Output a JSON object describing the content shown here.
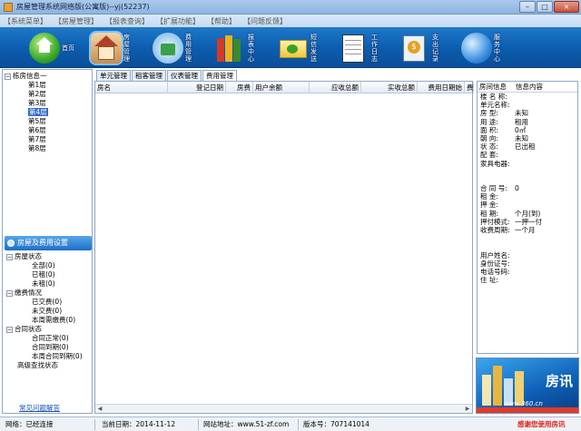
{
  "window": {
    "title": "房屋管理系统网络版(公寓版)--yj(52237)",
    "buttons": [
      "–",
      "□",
      "×"
    ]
  },
  "menu": [
    "【系统菜单】",
    "【房屋管理】",
    "【报表查询】",
    "【扩展功能】",
    "【帮助】",
    "【问题反馈】"
  ],
  "toolbar": [
    {
      "label": "首页",
      "icon": "home-icon"
    },
    {
      "label": "房屋管理",
      "icon": "house-icon"
    },
    {
      "label": "费用管理",
      "icon": "money-house-icon"
    },
    {
      "label": "报表中心",
      "icon": "report-books-icon"
    },
    {
      "label": "短信发送",
      "icon": "sms-envelope-icon"
    },
    {
      "label": "工作日志",
      "icon": "notebook-icon"
    },
    {
      "label": "支出记录",
      "icon": "expense-icon"
    },
    {
      "label": "服务中心",
      "icon": "globe-icon"
    }
  ],
  "tree": {
    "root": "栋房信息一",
    "floors": [
      "第1层",
      "第2层",
      "第3层",
      "第4层",
      "第5层",
      "第6层",
      "第7层",
      "第8层"
    ],
    "selected_index": 3
  },
  "section_header": "房屋及费用设置",
  "status_tree": [
    {
      "label": "房屋状态",
      "children": [
        "全部(0)",
        "已租(0)",
        "未租(0)"
      ]
    },
    {
      "label": "缴费情况",
      "children": [
        "已交费(0)",
        "未交费(0)",
        "本周需缴费(0)"
      ]
    },
    {
      "label": "合同状态",
      "children": [
        "合同正常(0)",
        "合同到期(0)",
        "本周合同到期(0)"
      ]
    },
    {
      "label": "高级查找状态",
      "children": []
    }
  ],
  "help_link": "常见问题解答",
  "tabs": [
    "单元管理",
    "租客管理",
    "仪表管理",
    "费用管理"
  ],
  "active_tab": 3,
  "grid_columns": [
    "房名",
    "登记日期",
    "房费",
    "用户余额",
    "应收总额",
    "实收总额",
    "费用日期始",
    "费"
  ],
  "info_panel": {
    "headers": [
      "房间信息",
      "信息内容"
    ],
    "rows": [
      {
        "label": "楼 名 称:",
        "value": ""
      },
      {
        "label": "单元名称:",
        "value": ""
      },
      {
        "label": "房    型:",
        "value": "未知"
      },
      {
        "label": "用    途:",
        "value": "租用"
      },
      {
        "label": "面    积:",
        "value": "0㎡"
      },
      {
        "label": "朝    向:",
        "value": "未知"
      },
      {
        "label": "状    态:",
        "value": "已出租"
      },
      {
        "label": "配    套:",
        "value": ""
      },
      {
        "label": "家具电器:",
        "value": ""
      },
      {
        "label": "",
        "value": ""
      },
      {
        "label": "",
        "value": ""
      },
      {
        "label": "合 同 号:",
        "value": "0"
      },
      {
        "label": "租    金:",
        "value": ""
      },
      {
        "label": "押    金:",
        "value": ""
      },
      {
        "label": "租    期:",
        "value": "个月(到)"
      },
      {
        "label": "押付模式:",
        "value": "一押一付"
      },
      {
        "label": "收费周期:",
        "value": "一个月"
      },
      {
        "label": "",
        "value": ""
      },
      {
        "label": "",
        "value": ""
      },
      {
        "label": "用户姓名:",
        "value": ""
      },
      {
        "label": "身份证号:",
        "value": ""
      },
      {
        "label": "电话号码:",
        "value": ""
      },
      {
        "label": "住    址:",
        "value": ""
      }
    ]
  },
  "ad": {
    "brand": "房讯",
    "site": "www.360.cn"
  },
  "status": {
    "network": "网络：已经连接",
    "date": "当前日期：2014-11-12",
    "url": "网站地址：www.51-zf.com",
    "version": "版本号：707141014",
    "thanks": "感谢您使用房讯"
  },
  "colors": {
    "toolbar_blue": "#0c5eb0",
    "selection": "#3169c6",
    "thanks_red": "#e0201a"
  }
}
